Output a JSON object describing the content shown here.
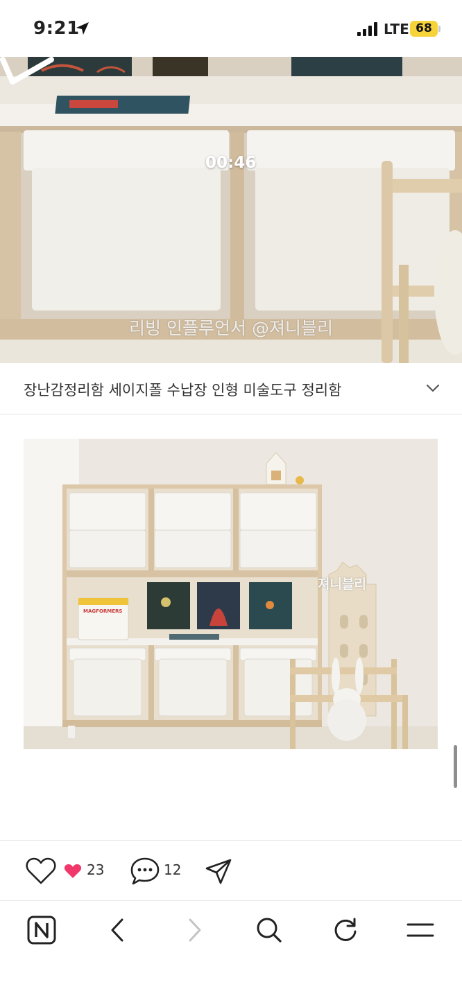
{
  "status_bar": {
    "time": "9:21",
    "network": "LTE",
    "battery": "68",
    "battery_color": "#f7d33b"
  },
  "video": {
    "duration": "00:46",
    "watermark": "리빙 인플루언서 @져니블리"
  },
  "post": {
    "title": "장난감정리함 세이지폴 수납장 인형 미술도구 정리함"
  },
  "photo": {
    "watermark": "져니블리",
    "box_label": "MAGFORMERS"
  },
  "actions": {
    "like_count": "23",
    "comment_count": "12",
    "heart_color": "#f0386b"
  },
  "nav": {
    "icons": [
      "naver-icon",
      "back-icon",
      "forward-icon",
      "search-icon",
      "refresh-icon",
      "menu-icon"
    ]
  }
}
